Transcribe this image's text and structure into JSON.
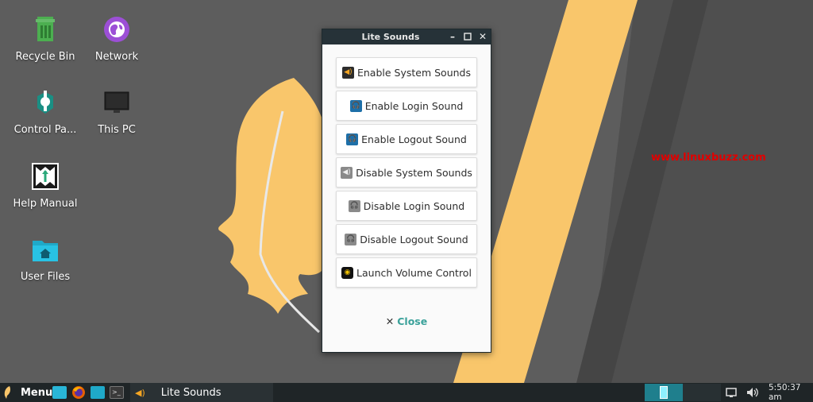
{
  "desktop": {
    "icons": [
      {
        "label": "Recycle Bin",
        "icon": "recycle-bin-icon"
      },
      {
        "label": "Network",
        "icon": "network-globe-icon"
      },
      {
        "label": "Control Pa...",
        "icon": "control-panel-icon"
      },
      {
        "label": "This PC",
        "icon": "monitor-icon"
      },
      {
        "label": "Help Manual",
        "icon": "help-manual-icon"
      },
      {
        "label": "User Files",
        "icon": "home-folder-icon"
      }
    ],
    "watermark": "www.linuxbuzz.com"
  },
  "window": {
    "title": "Lite Sounds",
    "buttons": [
      {
        "label": "Enable System Sounds",
        "icon": "speaker-on-icon"
      },
      {
        "label": "Enable Login Sound",
        "icon": "headphones-color-icon"
      },
      {
        "label": "Enable Logout Sound",
        "icon": "headphones-color-icon"
      },
      {
        "label": "Disable System Sounds",
        "icon": "speaker-off-icon"
      },
      {
        "label": "Disable Login Sound",
        "icon": "headphones-gray-icon"
      },
      {
        "label": "Disable Logout Sound",
        "icon": "headphones-gray-icon"
      },
      {
        "label": "Launch Volume Control",
        "icon": "volume-control-icon"
      }
    ],
    "close_label": "Close"
  },
  "taskbar": {
    "menu_label": "Menu",
    "task_label": "Lite Sounds",
    "clock": "5:50:37 am"
  },
  "colors": {
    "desktop_bg": "#5d5d5d",
    "wallpaper_yellow": "#f9c66b",
    "titlebar": "#263238",
    "accent": "#3aa19a",
    "taskbar": "#1f2527"
  }
}
